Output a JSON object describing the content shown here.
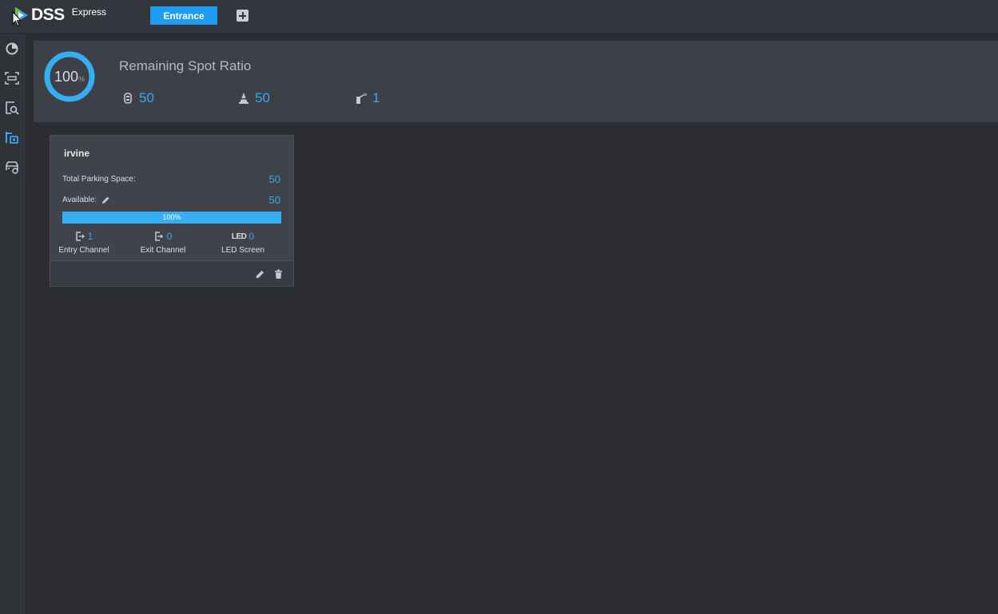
{
  "app": {
    "logo_text": "DSS",
    "logo_sub": "Express"
  },
  "tabs": {
    "active_label": "Entrance"
  },
  "sidebar": {
    "items": [
      "dashboard-icon",
      "scan-frame-icon",
      "search-record-icon",
      "parking-lot-icon",
      "vehicle-icon"
    ],
    "active": "parking-lot-icon"
  },
  "summary": {
    "title": "Remaining Spot Ratio",
    "ratio_value": "100",
    "ratio_unit": "%",
    "ratio_fraction": 1.0,
    "parking_spaces": "50",
    "available_spaces": "50",
    "entrances": "1"
  },
  "lots": [
    {
      "name": "irvine",
      "total_label": "Total Parking Space:",
      "total_value": "50",
      "available_label": "Available:",
      "available_value": "50",
      "progress_fraction": 1.0,
      "progress_text": "100%",
      "entry_count": "1",
      "entry_label": "Entry Channel",
      "exit_count": "0",
      "exit_label": "Exit Channel",
      "led_icon_text": "LED",
      "led_count": "0",
      "led_label": "LED Screen"
    }
  ],
  "colors": {
    "accent": "#1e9df2",
    "value_blue": "#37a8f0",
    "panel": "#3d4047",
    "background": "#2b2d32"
  }
}
